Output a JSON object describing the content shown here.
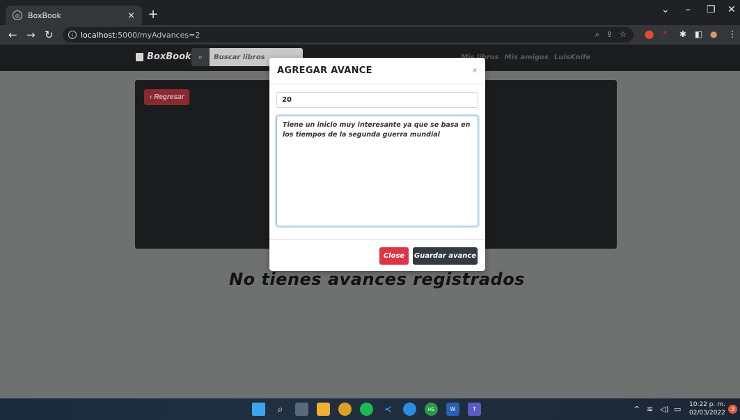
{
  "browser": {
    "tab_title": "BoxBook",
    "tab_close": "×",
    "new_tab": "+",
    "url_host": "localhost",
    "url_path": ":5000/myAdvances=2",
    "window_controls": [
      "⌄",
      "–",
      "❐",
      "✕"
    ]
  },
  "app": {
    "brand": "BoxBook",
    "search_placeholder": "Buscar libros",
    "nav_links": [
      "Mis libros",
      "Mis amigos",
      "LuisKnife"
    ],
    "back_label": "‹ Regresar",
    "empty_message": "No tienes avances registrados"
  },
  "modal": {
    "title": "AGREGAR AVANCE",
    "close_icon": "×",
    "page_value": "20",
    "comment_value": "Tiene un inicio muy interesante ya que se basa en los tiempos de la segunda guerra mundial",
    "close_label": "Close",
    "save_label": "Guardar avance"
  },
  "taskbar": {
    "time": "10:22 p. m.",
    "date": "02/03/2022",
    "notifications": "3"
  },
  "colors": {
    "danger": "#dc3545",
    "dark": "#343a40",
    "backdrop": "#6f7070",
    "focus_border": "#8bb8e8"
  }
}
